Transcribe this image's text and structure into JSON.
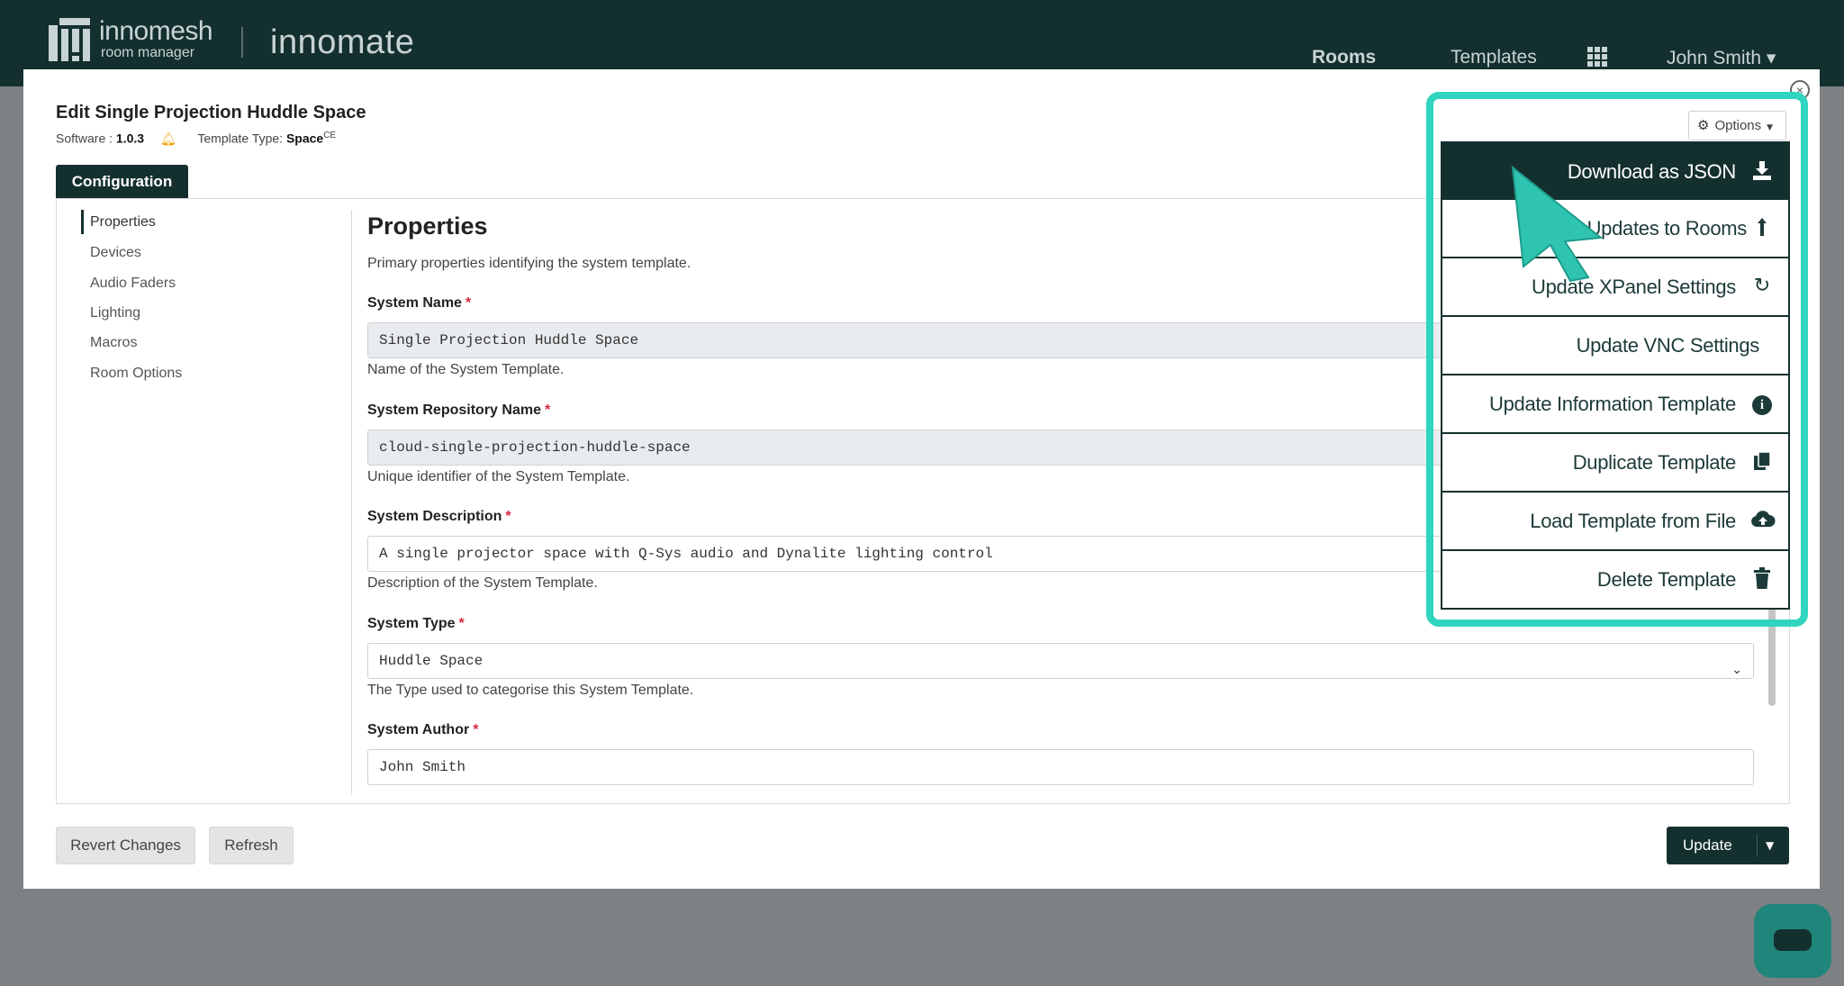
{
  "app": {
    "brand_name": "innomesh",
    "brand_sub": "room manager",
    "product": "innomate",
    "nav": {
      "rooms": "Rooms",
      "templates": "Templates",
      "user": "John Smith ▾"
    }
  },
  "modal": {
    "title": "Edit Single Projection Huddle Space",
    "software_label": "Software :",
    "software_version": "1.0.3",
    "template_type_label": "Template Type:",
    "template_type_value": "Space",
    "template_type_edition": "CE",
    "close_glyph": "×",
    "tab": "Configuration"
  },
  "sidenav": {
    "items": [
      "Properties",
      "Devices",
      "Audio Faders",
      "Lighting",
      "Macros",
      "Room Options"
    ],
    "active": "Properties"
  },
  "properties": {
    "heading": "Properties",
    "description": "Primary properties identifying the system template.",
    "required_mark": "*",
    "fields": [
      {
        "label": "System Name",
        "value": "Single Projection Huddle Space",
        "help": "Name of the System Template."
      },
      {
        "label": "System Repository Name",
        "value": "cloud-single-projection-huddle-space",
        "help": "Unique identifier of the System Template."
      },
      {
        "label": "System Description",
        "value": "A single projector space with Q-Sys audio and Dynalite lighting control",
        "help": "Description of the System Template."
      },
      {
        "label": "System Type",
        "value": "Huddle Space",
        "help": "The Type used to categorise this System Template."
      },
      {
        "label": "System Author",
        "value": "John Smith",
        "help": ""
      }
    ]
  },
  "footer": {
    "revert": "Revert Changes",
    "refresh": "Refresh",
    "update": "Update"
  },
  "options": {
    "button": "Options",
    "items": [
      {
        "label": "Download as JSON",
        "icon": "download-icon"
      },
      {
        "label": "Updates to Rooms",
        "icon": "arrow-up-icon"
      },
      {
        "label": "Update XPanel Settings",
        "icon": "sync-icon"
      },
      {
        "label": "Update VNC Settings",
        "icon": ""
      },
      {
        "label": "Update Information Template",
        "icon": "info-icon"
      },
      {
        "label": "Duplicate Template",
        "icon": "copy-icon"
      },
      {
        "label": "Load Template from File",
        "icon": "cloud-upload-icon"
      },
      {
        "label": "Delete Template",
        "icon": "trash-icon"
      }
    ]
  },
  "colors": {
    "brand_dark": "#14302e",
    "highlight": "#2fd5bf",
    "required": "#d6263c"
  }
}
